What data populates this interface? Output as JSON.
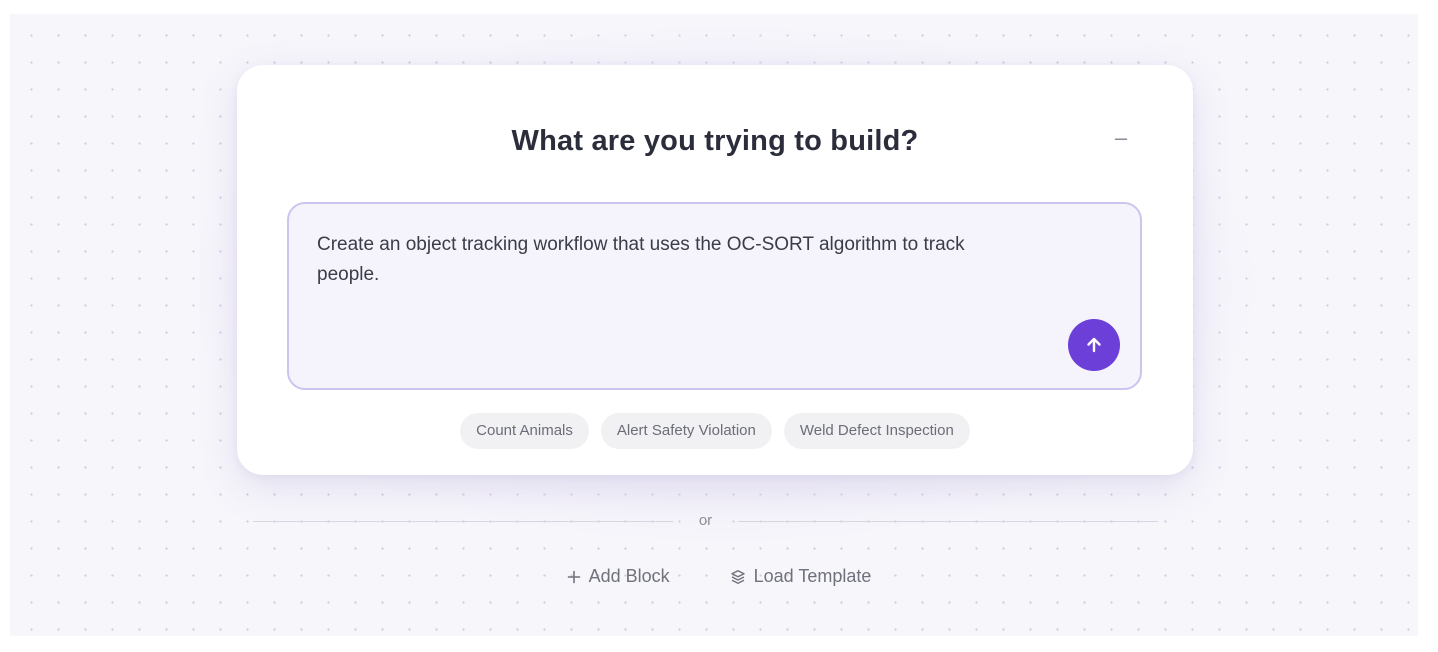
{
  "card": {
    "title": "What are you trying to build?",
    "minimize_label": "–",
    "prompt_text": "Create an object tracking workflow that uses the OC-SORT algorithm to track people.",
    "send_icon": "arrow-up-icon"
  },
  "suggestions": [
    {
      "label": "Count Animals"
    },
    {
      "label": "Alert Safety Violation"
    },
    {
      "label": "Weld Defect Inspection"
    }
  ],
  "divider": {
    "label": "or"
  },
  "actions": {
    "add_block": {
      "icon": "plus-icon",
      "label": "Add Block"
    },
    "load_template": {
      "icon": "layers-icon",
      "label": "Load Template"
    }
  },
  "colors": {
    "accent": "#6c3fd9",
    "prompt_border": "#cdc4ee",
    "prompt_bg": "#f5f4fc",
    "title": "#2b2d3a"
  }
}
